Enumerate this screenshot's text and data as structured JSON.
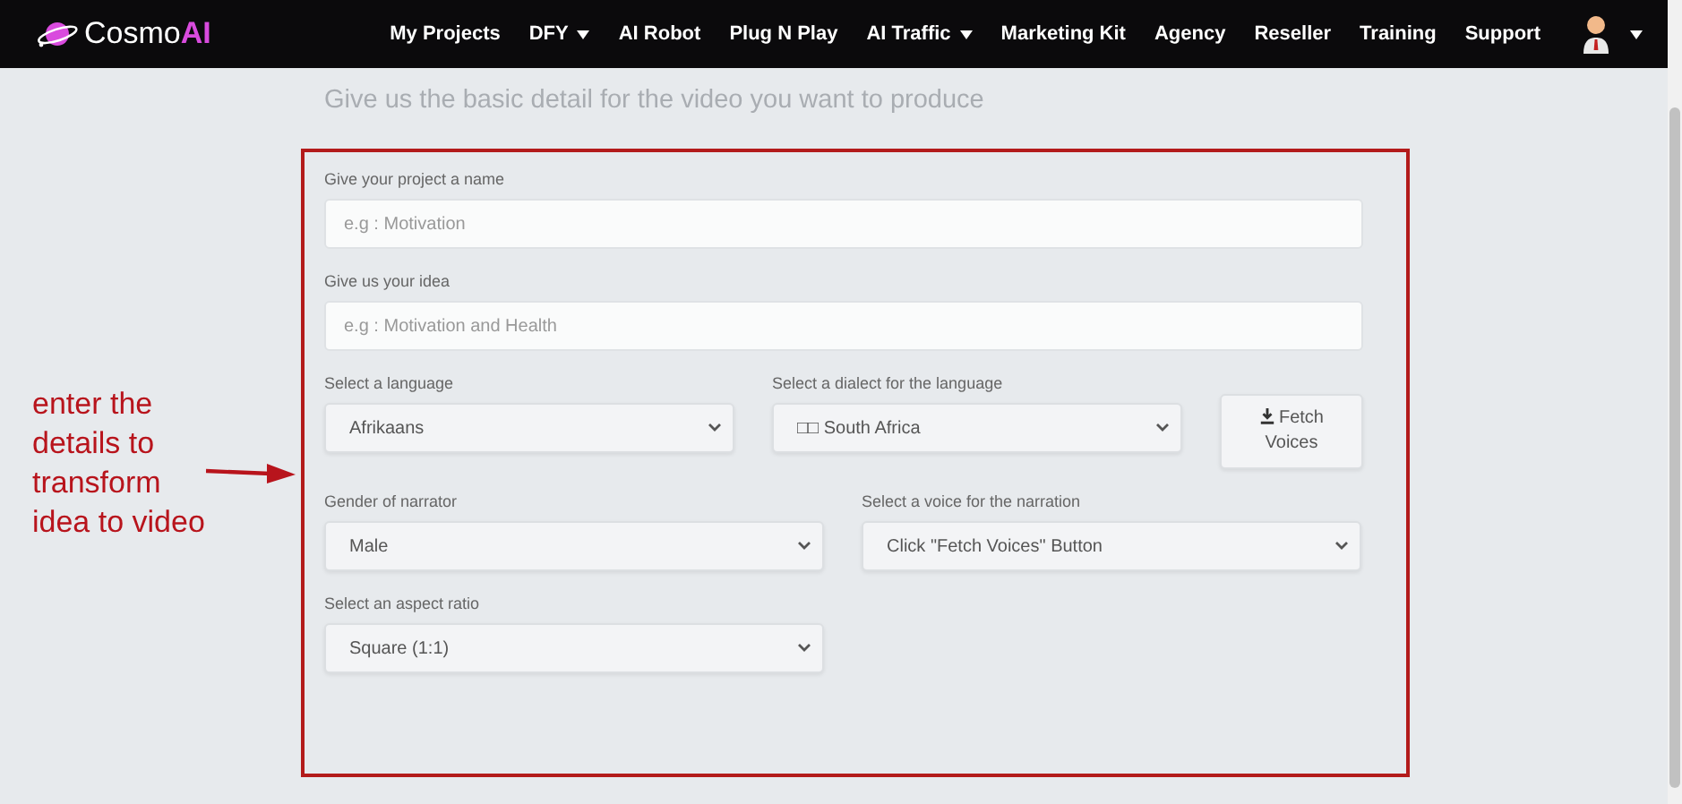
{
  "navbar": {
    "brand": {
      "name": "Cosmo",
      "accent": "AI"
    },
    "items": [
      {
        "label": "My Projects",
        "dropdown": false
      },
      {
        "label": "DFY",
        "dropdown": true
      },
      {
        "label": "AI Robot",
        "dropdown": false
      },
      {
        "label": "Plug N Play",
        "dropdown": false
      },
      {
        "label": "AI Traffic",
        "dropdown": true
      },
      {
        "label": "Marketing Kit",
        "dropdown": false
      },
      {
        "label": "Agency",
        "dropdown": false
      },
      {
        "label": "Reseller",
        "dropdown": false
      },
      {
        "label": "Training",
        "dropdown": false
      },
      {
        "label": "Support",
        "dropdown": false
      }
    ],
    "user_menu": {
      "dropdown": true
    }
  },
  "heading": "Give us the basic detail for the video you want to produce",
  "annotation": "enter the details to transform idea to video",
  "form": {
    "rows": [
      {
        "fields": [
          {
            "kind": "text",
            "label": "Give your project a name",
            "placeholder": "e.g : Motivation"
          }
        ]
      },
      {
        "fields": [
          {
            "kind": "text",
            "label": "Give us your idea",
            "placeholder": "e.g : Motivation and Health"
          }
        ]
      },
      {
        "fields": [
          {
            "kind": "select",
            "label": "Select a language",
            "value": "Afrikaans"
          },
          {
            "kind": "select",
            "label": "Select a dialect for the language",
            "value": "□□ South Africa"
          },
          {
            "kind": "button",
            "label": "Fetch Voices"
          }
        ]
      },
      {
        "fields": [
          {
            "kind": "select",
            "label": "Gender of narrator",
            "value": "Male"
          },
          {
            "kind": "select",
            "label": "Select a voice for the narration",
            "value": "Click \"Fetch Voices\" Button"
          }
        ]
      },
      {
        "fields": [
          {
            "kind": "select",
            "label": "Select an aspect ratio",
            "value": "Square (1:1)"
          }
        ]
      }
    ]
  }
}
